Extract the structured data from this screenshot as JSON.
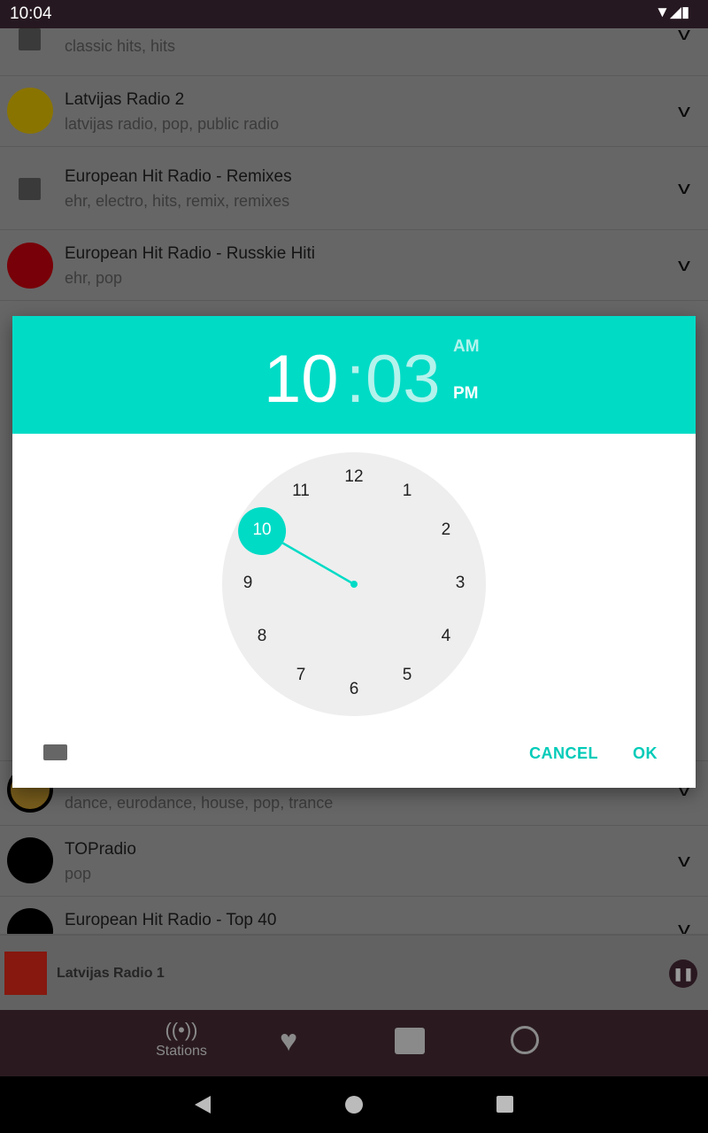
{
  "status_bar": {
    "time": "10:04"
  },
  "stations": [
    {
      "name": "",
      "tags": "classic hits, hits"
    },
    {
      "name": "Latvijas Radio 2",
      "tags": "latvijas radio, pop, public radio"
    },
    {
      "name": "European Hit Radio - Remixes",
      "tags": "ehr, electro, hits, remix, remixes"
    },
    {
      "name": "European Hit Radio - Russkie Hiti",
      "tags": "ehr, pop"
    },
    {
      "name": "",
      "tags": "dance, eurodance, house, pop, trance"
    },
    {
      "name": "TOPradio",
      "tags": "pop"
    },
    {
      "name": "European Hit Radio - Top 40",
      "tags": ""
    }
  ],
  "player": {
    "station": "Latvijas Radio 1"
  },
  "bottom_nav": {
    "stations_label": "Stations"
  },
  "dialog": {
    "hour": "10",
    "sep": ":",
    "minute": "03",
    "am": "AM",
    "pm": "PM",
    "selected_period": "PM",
    "selected_hour": 10,
    "clock_numbers": [
      "12",
      "1",
      "2",
      "3",
      "4",
      "5",
      "6",
      "7",
      "8",
      "9",
      "10",
      "11"
    ],
    "cancel": "CANCEL",
    "ok": "OK"
  },
  "colors": {
    "accent": "#00dbc6",
    "status_bar": "#261820"
  }
}
